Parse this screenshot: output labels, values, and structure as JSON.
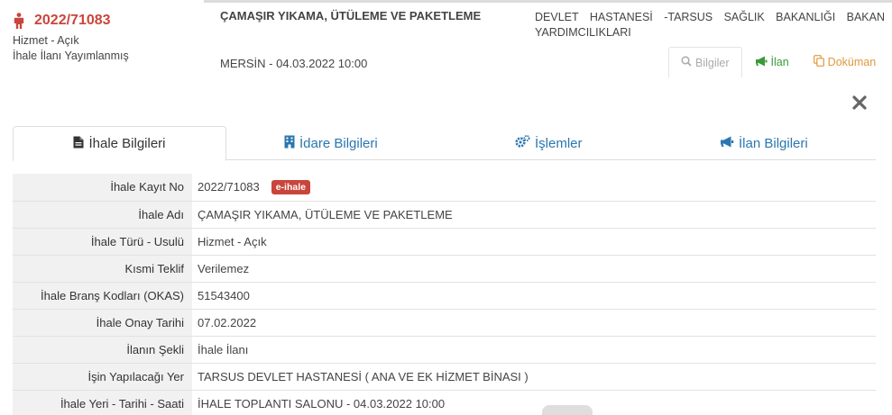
{
  "header": {
    "record_no": "2022/71083",
    "type_line": "Hizmet - Açık",
    "status_line": "İhale İlanı Yayımlanmış",
    "title": "ÇAMAŞIR YIKAMA, ÜTÜLEME VE PAKETLEME",
    "place_date": "MERSİN - 04.03.2022 10:00",
    "authority": "DEVLET HASTANESİ -TARSUS SAĞLIK BAKANLIĞI BAKAN YARDIMCILIKLARI",
    "accent_color": "#c9453c"
  },
  "actions": {
    "bilgiler_label": "Bilgiler",
    "ilan_label": "İlan",
    "dokuman_label": "Doküman",
    "icons": [
      "search-icon",
      "bullhorn-icon",
      "copy-icon",
      "close-icon"
    ]
  },
  "tabs": [
    {
      "label": "İhale Bilgileri",
      "icon": "file-icon",
      "active": true
    },
    {
      "label": "İdare Bilgileri",
      "icon": "building-icon",
      "active": false
    },
    {
      "label": "İşlemler",
      "icon": "gears-icon",
      "active": false
    },
    {
      "label": "İlan Bilgileri",
      "icon": "bullhorn-icon",
      "active": false
    }
  ],
  "details": {
    "badge": "e-ihale",
    "rows": [
      {
        "label": "İhale Kayıt No",
        "value": "2022/71083"
      },
      {
        "label": "İhale Adı",
        "value": "ÇAMAŞIR YIKAMA, ÜTÜLEME VE PAKETLEME"
      },
      {
        "label": "İhale Türü - Usulü",
        "value": "Hizmet - Açık"
      },
      {
        "label": "Kısmi Teklif",
        "value": "Verilemez"
      },
      {
        "label": "İhale Branş Kodları (OKAS)",
        "value": "51543400"
      },
      {
        "label": "İhale Onay Tarihi",
        "value": "07.02.2022"
      },
      {
        "label": "İlanın Şekli",
        "value": "İhale İlanı"
      },
      {
        "label": "İşin Yapılacağı Yer",
        "value": "TARSUS DEVLET HASTANESİ ( ANA VE EK HİZMET BİNASI )"
      },
      {
        "label": "İhale Yeri - Tarihi - Saati",
        "value": "İHALE TOPLANTI SALONU - 04.03.2022 10:00"
      }
    ]
  }
}
